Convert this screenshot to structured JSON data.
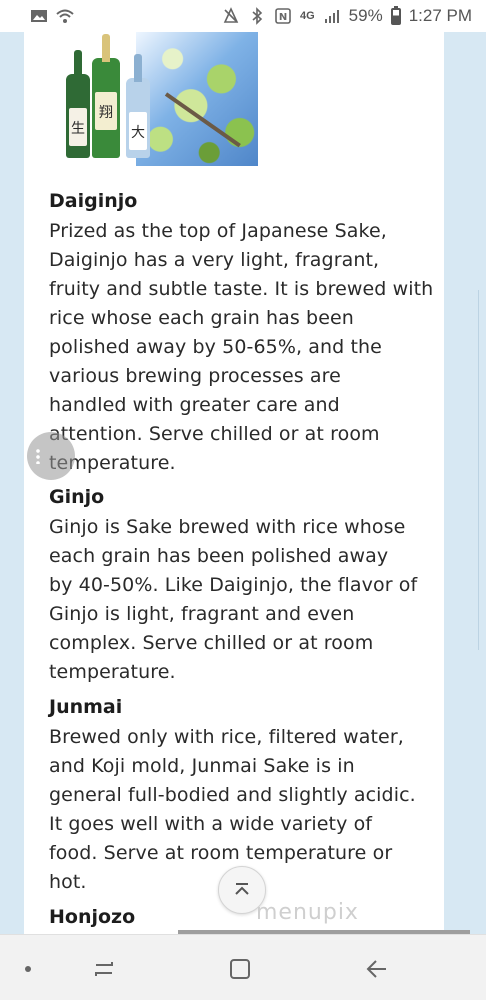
{
  "status_bar": {
    "battery": "59%",
    "time": "1:27 PM",
    "network": "4G",
    "icons": [
      "gallery-icon",
      "wifi-icon",
      "silent-icon",
      "bluetooth-icon",
      "nfc-icon",
      "signal-icon",
      "battery-icon"
    ]
  },
  "hero": {
    "bottle_marks": [
      "生",
      "翔",
      "大"
    ]
  },
  "sections": [
    {
      "heading": "Daiginjo",
      "lines": [
        "Prized as the top of Japanese Sake,",
        "Daiginjo has a very light, fragrant,",
        "fruity and subtle taste. It is brewed with",
        "rice whose each grain has been",
        "polished away by 50-65%, and the",
        "various brewing processes are",
        "handled with greater care and",
        "attention. Serve chilled or at room",
        "temperature."
      ]
    },
    {
      "heading": "Ginjo",
      "lines": [
        "Ginjo is Sake brewed with rice whose",
        "each grain has been polished away",
        "by 40-50%. Like Daiginjo, the flavor of",
        "Ginjo is light, fragrant and even",
        "complex. Serve chilled or at room",
        "temperature."
      ]
    },
    {
      "heading": "Junmai",
      "lines": [
        "Brewed only with rice, filtered water,",
        "and Koji mold, Junmai Sake is in",
        "general full-bodied and slightly acidic.",
        "It goes well with a wide variety of",
        "food. Serve at room temperature or",
        "hot."
      ]
    },
    {
      "heading": "Honjozo",
      "lines": []
    }
  ],
  "watermark": "menupix",
  "nav": {
    "buttons": [
      "dot-icon",
      "recent-apps-icon",
      "home-icon",
      "back-icon"
    ]
  },
  "colors": {
    "page_side": "#d7e8f3",
    "card": "#ffffff",
    "text": "#2a2a2a"
  }
}
